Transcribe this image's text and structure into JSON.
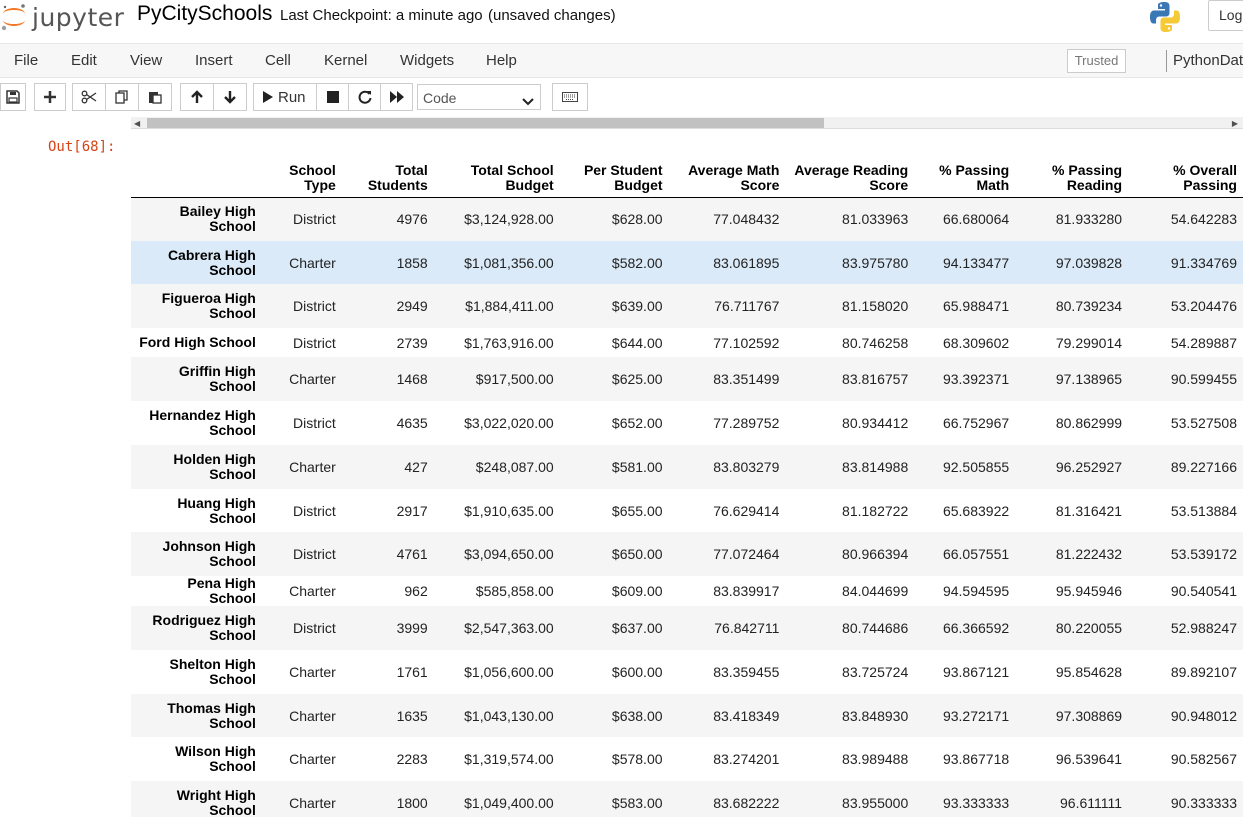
{
  "header": {
    "logo_text": "jupyter",
    "notebook_name": "PyCitySchools",
    "checkpoint": "Last Checkpoint: a minute ago",
    "unsaved": "(unsaved changes)",
    "logout_label": "Logout"
  },
  "menubar": {
    "items": [
      "File",
      "Edit",
      "View",
      "Insert",
      "Cell",
      "Kernel",
      "Widgets",
      "Help"
    ],
    "trusted_label": "Trusted",
    "kernel_name": "PythonData"
  },
  "toolbar": {
    "run_label": "Run",
    "cell_type": "Code"
  },
  "output": {
    "prompt": "Out[68]:",
    "columns": [
      [
        "School",
        "Type"
      ],
      [
        "Total",
        "Students"
      ],
      [
        "Total School",
        "Budget"
      ],
      [
        "Per Student",
        "Budget"
      ],
      [
        "Average Math",
        "Score"
      ],
      [
        "Average Reading",
        "Score"
      ],
      [
        "% Passing",
        "Math"
      ],
      [
        "% Passing",
        "Reading"
      ],
      [
        "% Overall",
        "Passing"
      ]
    ],
    "rows": [
      {
        "name": [
          "Bailey High",
          "School"
        ],
        "values": [
          "District",
          "4976",
          "$3,124,928.00",
          "$628.00",
          "77.048432",
          "81.033963",
          "66.680064",
          "81.933280",
          "54.642283"
        ]
      },
      {
        "name": [
          "Cabrera High",
          "School"
        ],
        "values": [
          "Charter",
          "1858",
          "$1,081,356.00",
          "$582.00",
          "83.061895",
          "83.975780",
          "94.133477",
          "97.039828",
          "91.334769"
        ]
      },
      {
        "name": [
          "Figueroa High",
          "School"
        ],
        "values": [
          "District",
          "2949",
          "$1,884,411.00",
          "$639.00",
          "76.711767",
          "81.158020",
          "65.988471",
          "80.739234",
          "53.204476"
        ]
      },
      {
        "name": [
          "Ford High School"
        ],
        "values": [
          "District",
          "2739",
          "$1,763,916.00",
          "$644.00",
          "77.102592",
          "80.746258",
          "68.309602",
          "79.299014",
          "54.289887"
        ]
      },
      {
        "name": [
          "Griffin High",
          "School"
        ],
        "values": [
          "Charter",
          "1468",
          "$917,500.00",
          "$625.00",
          "83.351499",
          "83.816757",
          "93.392371",
          "97.138965",
          "90.599455"
        ]
      },
      {
        "name": [
          "Hernandez High",
          "School"
        ],
        "values": [
          "District",
          "4635",
          "$3,022,020.00",
          "$652.00",
          "77.289752",
          "80.934412",
          "66.752967",
          "80.862999",
          "53.527508"
        ]
      },
      {
        "name": [
          "Holden High",
          "School"
        ],
        "values": [
          "Charter",
          "427",
          "$248,087.00",
          "$581.00",
          "83.803279",
          "83.814988",
          "92.505855",
          "96.252927",
          "89.227166"
        ]
      },
      {
        "name": [
          "Huang High",
          "School"
        ],
        "values": [
          "District",
          "2917",
          "$1,910,635.00",
          "$655.00",
          "76.629414",
          "81.182722",
          "65.683922",
          "81.316421",
          "53.513884"
        ]
      },
      {
        "name": [
          "Johnson High",
          "School"
        ],
        "values": [
          "District",
          "4761",
          "$3,094,650.00",
          "$650.00",
          "77.072464",
          "80.966394",
          "66.057551",
          "81.222432",
          "53.539172"
        ]
      },
      {
        "name": [
          "Pena High School"
        ],
        "values": [
          "Charter",
          "962",
          "$585,858.00",
          "$609.00",
          "83.839917",
          "84.044699",
          "94.594595",
          "95.945946",
          "90.540541"
        ]
      },
      {
        "name": [
          "Rodriguez High",
          "School"
        ],
        "values": [
          "District",
          "3999",
          "$2,547,363.00",
          "$637.00",
          "76.842711",
          "80.744686",
          "66.366592",
          "80.220055",
          "52.988247"
        ]
      },
      {
        "name": [
          "Shelton High",
          "School"
        ],
        "values": [
          "Charter",
          "1761",
          "$1,056,600.00",
          "$600.00",
          "83.359455",
          "83.725724",
          "93.867121",
          "95.854628",
          "89.892107"
        ]
      },
      {
        "name": [
          "Thomas High",
          "School"
        ],
        "values": [
          "Charter",
          "1635",
          "$1,043,130.00",
          "$638.00",
          "83.418349",
          "83.848930",
          "93.272171",
          "97.308869",
          "90.948012"
        ]
      },
      {
        "name": [
          "Wilson High",
          "School"
        ],
        "values": [
          "Charter",
          "2283",
          "$1,319,574.00",
          "$578.00",
          "83.274201",
          "83.989488",
          "93.867718",
          "96.539641",
          "90.582567"
        ]
      },
      {
        "name": [
          "Wright High",
          "School"
        ],
        "values": [
          "Charter",
          "1800",
          "$1,049,400.00",
          "$583.00",
          "83.682222",
          "83.955000",
          "93.333333",
          "96.611111",
          "90.333333"
        ]
      }
    ],
    "hovered_row": 1
  },
  "colors": {
    "prompt_out": "#d84315",
    "row_hover": "#daeaf8",
    "row_stripe": "#f5f5f5"
  }
}
